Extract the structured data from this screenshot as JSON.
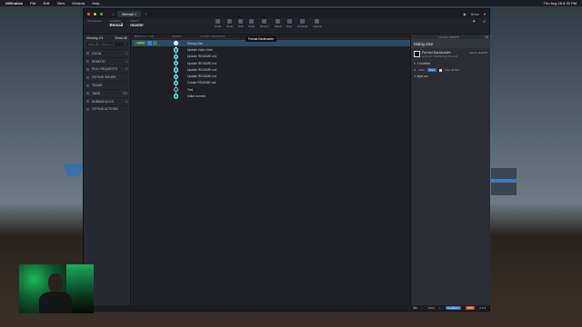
{
  "menubar": {
    "app": "GitKraken",
    "items": [
      "File",
      "Edit",
      "View",
      "Window",
      "Help"
    ],
    "clock": "Thu Aug 18 8:33 PM"
  },
  "app": {
    "tab_label": "Bemail",
    "toolbar": {
      "workspace_label": "Workspaces",
      "workspace_value": "",
      "repo_label": "repository",
      "repo_value": "Bemail",
      "branch_label": "branch",
      "branch_value": "master",
      "buttons": [
        "Undo",
        "Redo",
        "Pull",
        "Push",
        "Branch",
        "Stash",
        "Pop",
        "Terminal",
        "Actions"
      ],
      "user": "Brian"
    },
    "sidebar": {
      "viewing_label": "Viewing",
      "viewing_count": "1/1",
      "show_all": "Show All",
      "filter_placeholder": "Filter (⌘ + Option + f)",
      "items": [
        {
          "label": "LOCAL",
          "count": "1"
        },
        {
          "label": "REMOTE",
          "count": "1"
        },
        {
          "label": "PULL REQUESTS",
          "count": "0"
        },
        {
          "label": "GITHUB ISSUES",
          "count": ""
        },
        {
          "label": "TEAMS",
          "count": ""
        },
        {
          "label": "TAGS",
          "count": "0/0"
        },
        {
          "label": "SUBMODULES",
          "count": "0"
        },
        {
          "label": "GITHUB ACTIONS",
          "count": ""
        }
      ]
    },
    "graph": {
      "headers": [
        "BRANCH / TAG",
        "GRAPH",
        "COMMIT MESSAGE"
      ],
      "branch_tag": "master",
      "tooltip": "Parhad Davidzadeh",
      "commits": [
        "Dialog Size",
        "Update index.html",
        "Update README.md",
        "Update README.md",
        "Update README.md",
        "Update README.md",
        "Create README.md",
        "Test",
        "Initial commit"
      ]
    },
    "detail": {
      "commit_label": "commit:",
      "commit_sha": "3d6f278",
      "title": "Dialog Size",
      "author": "Parhad Davidzadeh",
      "authored": "authored 7/18/2022 @ 8:12 AM",
      "parent_label": "parent:",
      "parent_sha": "4ba47f8",
      "modified": "1 modified",
      "path_btn": "Path",
      "tree_btn": "Tree",
      "view_all": "View all files",
      "file": "style.css"
    },
    "statusbar": {
      "zoom": "100%",
      "feedback": "Feedback",
      "pro": "PRO",
      "version": "8.8.0"
    }
  }
}
